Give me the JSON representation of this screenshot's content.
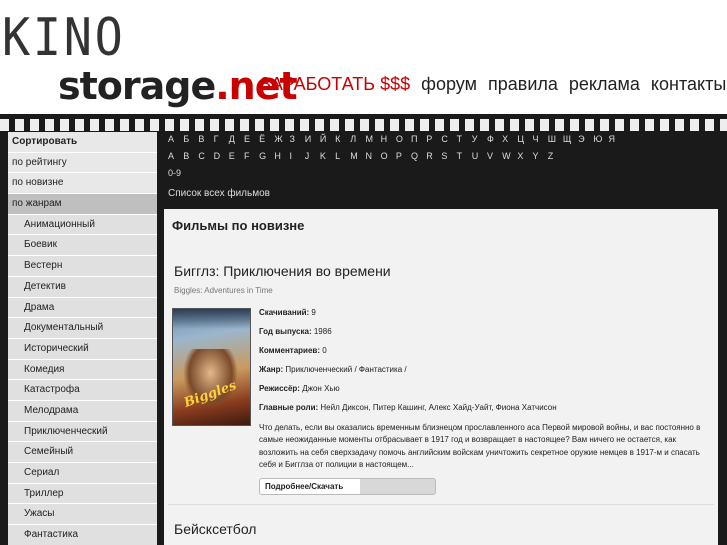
{
  "logo": {
    "line1": "KINO",
    "line2": "storage",
    "line2_tld": ".net"
  },
  "topnav": {
    "earn": "ЗАРАБОТАТЬ $$$",
    "forum": "форум",
    "rules": "правила",
    "ads": "реклама",
    "contacts": "контакты"
  },
  "sidebar": {
    "items": [
      "Сортировать",
      "по рейтингу",
      "по новизне",
      "по жанрам"
    ],
    "genres": [
      "Анимационный",
      "Боевик",
      "Вестерн",
      "Детектив",
      "Драма",
      "Документальный",
      "Исторический",
      "Комедия",
      "Катастрофа",
      "Мелодрама",
      "Приключенческий",
      "Семейный",
      "Сериал",
      "Триллер",
      "Ужасы",
      "Фантастика"
    ]
  },
  "alphabet": {
    "cyrillic": [
      "А",
      "Б",
      "В",
      "Г",
      "Д",
      "Е",
      "Ё",
      "Ж",
      "З",
      "И",
      "Й",
      "К",
      "Л",
      "М",
      "Н",
      "О",
      "П",
      "Р",
      "С",
      "Т",
      "У",
      "Ф",
      "Х",
      "Ц",
      "Ч",
      "Ш",
      "Щ",
      "Э",
      "Ю",
      "Я"
    ],
    "latin": [
      "A",
      "B",
      "C",
      "D",
      "E",
      "F",
      "G",
      "H",
      "I",
      "J",
      "K",
      "L",
      "M",
      "N",
      "O",
      "P",
      "Q",
      "R",
      "S",
      "T",
      "U",
      "V",
      "W",
      "X",
      "Y",
      "Z"
    ],
    "digits": "0-9",
    "all_films": "Список всех фильмов"
  },
  "main": {
    "section_title": "Фильмы по новизне",
    "film": {
      "title": "Бигглз: Приключения во времени",
      "original_title": "Biggles: Adventures in Time",
      "poster_text": "Biggles",
      "downloads_label": "Скачиваний:",
      "downloads": "9",
      "year_label": "Год выпуска:",
      "year": "1986",
      "comments_label": "Комментариев:",
      "comments": "0",
      "genre_label": "Жанр:",
      "genre": "Приключенческий / Фантастика /",
      "director_label": "Режиссёр:",
      "director": "Джон Хью",
      "cast_label": "Главные роли:",
      "cast": "Нейл Диксон, Питер Кашинг, Алекс Хайд-Уайт, Фиона Хатчисон",
      "description": "Что делать, если вы оказались временным близнецом прославленного аса Первой мировой войны, и вас постоянно в самые неожиданные моменты отбрасывает в 1917 год и возвращает в настоящее? Вам ничего не остается, как возложить на себя сверхзадачу помочь английским войскам уничтожить секретное оружие немцев в 1917-м и спасать себя и Бигглза от полиции в настоящем...",
      "more_button": "Подробнее/Скачать"
    },
    "film2_title": "Бейсксетбол"
  }
}
